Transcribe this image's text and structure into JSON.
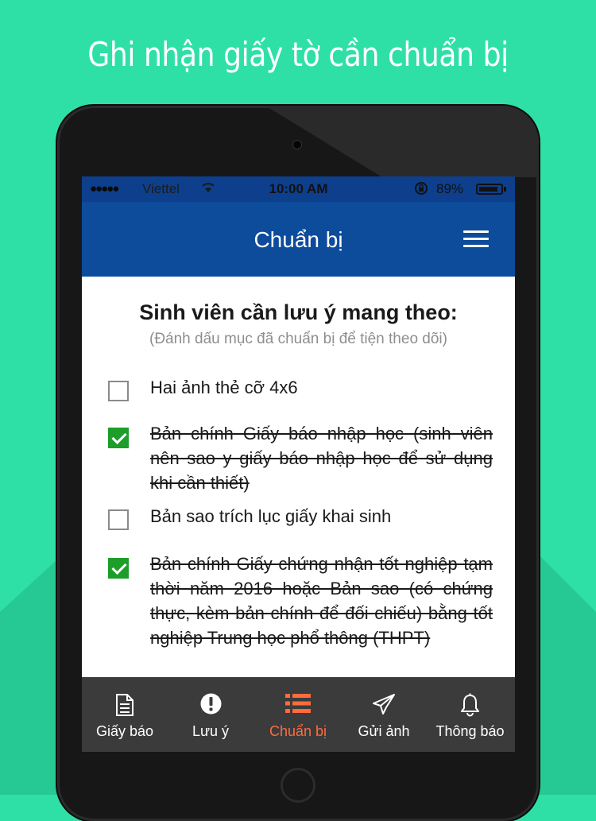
{
  "headline": "Ghi nhận giấy tờ cần chuẩn bị",
  "status_bar": {
    "signal": "●●●●●",
    "carrier": "Viettel",
    "time": "10:00 AM",
    "battery": "89%",
    "battery_level": 0.89
  },
  "navbar": {
    "title": "Chuẩn bị",
    "menu_icon": "hamburger-icon"
  },
  "content": {
    "heading": "Sinh viên cần lưu ý mang theo:",
    "subheading": "(Đánh dấu mục đã chuẩn bị để tiện theo dõi)",
    "items": [
      {
        "label": "Hai ảnh thẻ cỡ 4x6",
        "checked": false
      },
      {
        "label": "Bản chính Giấy báo nhập học (sinh viên nên sao y giấy báo nhập học để sử dụng khi cần thiết)",
        "checked": true
      },
      {
        "label": "Bản sao trích lục giấy khai sinh",
        "checked": false
      },
      {
        "label": "Bản chính Giấy chứng nhận tốt nghiệp tạm thời năm 2016 hoặc Bản sao (có chứng thực, kèm bản chính để đối chiếu) bằng tốt nghiệp Trung học phổ thông (THPT)",
        "checked": true
      }
    ]
  },
  "tabs": [
    {
      "label": "Giấy báo",
      "icon": "document-icon",
      "active": false
    },
    {
      "label": "Lưu ý",
      "icon": "exclamation-icon",
      "active": false
    },
    {
      "label": "Chuẩn bị",
      "icon": "list-icon",
      "active": true
    },
    {
      "label": "Gửi ảnh",
      "icon": "paper-plane-icon",
      "active": false
    },
    {
      "label": "Thông báo",
      "icon": "bell-icon",
      "active": false
    }
  ],
  "colors": {
    "background": "#2fe0a6",
    "nav_blue": "#0d4b9b",
    "checked_green": "#1d9e2a",
    "active_tab": "#ff6b3d",
    "tab_bar": "#3b3b3b"
  }
}
